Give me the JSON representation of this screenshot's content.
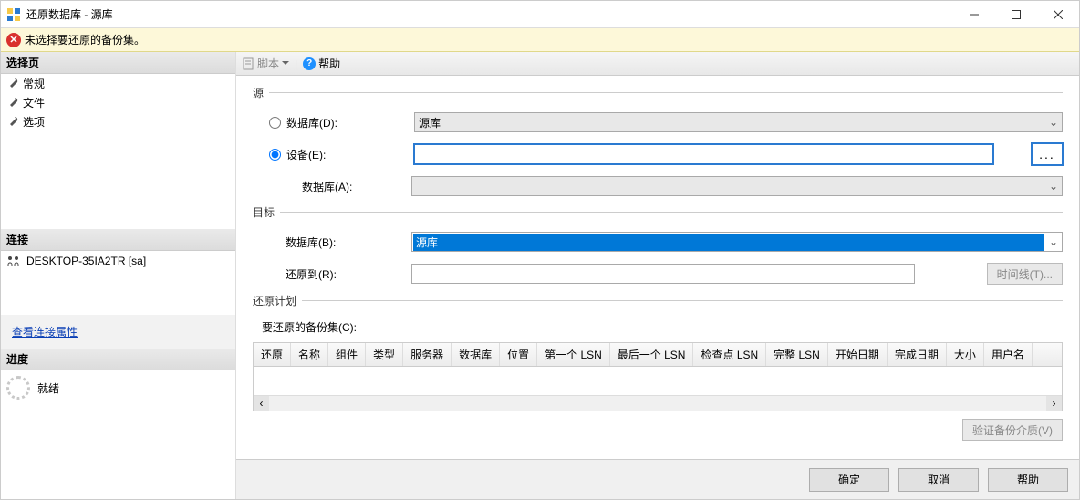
{
  "window": {
    "title": "还原数据库 - 源库"
  },
  "notice": {
    "text": "未选择要还原的备份集。"
  },
  "sidebar": {
    "pages_header": "选择页",
    "pages": [
      "常规",
      "文件",
      "选项"
    ],
    "conn_header": "连接",
    "conn_server": "DESKTOP-35IA2TR [sa]",
    "view_props": "查看连接属性",
    "progress_header": "进度",
    "progress_text": "就绪"
  },
  "toolbar": {
    "script": "脚本",
    "help": "帮助"
  },
  "source": {
    "group": "源",
    "radio_db": "数据库(D):",
    "db_value": "源库",
    "radio_device": "设备(E):",
    "device_value": "",
    "db_a_label": "数据库(A):",
    "db_a_value": ""
  },
  "target": {
    "group": "目标",
    "db_b_label": "数据库(B):",
    "db_b_value": "源库",
    "restore_to_label": "还原到(R):",
    "restore_to_value": "",
    "timeline_btn": "时间线(T)..."
  },
  "plan": {
    "group": "还原计划",
    "sets_label": "要还原的备份集(C):",
    "columns": [
      "还原",
      "名称",
      "组件",
      "类型",
      "服务器",
      "数据库",
      "位置",
      "第一个 LSN",
      "最后一个 LSN",
      "检查点 LSN",
      "完整 LSN",
      "开始日期",
      "完成日期",
      "大小",
      "用户名"
    ],
    "verify_btn": "验证备份介质(V)"
  },
  "buttons": {
    "ok": "确定",
    "cancel": "取消",
    "help": "帮助"
  }
}
